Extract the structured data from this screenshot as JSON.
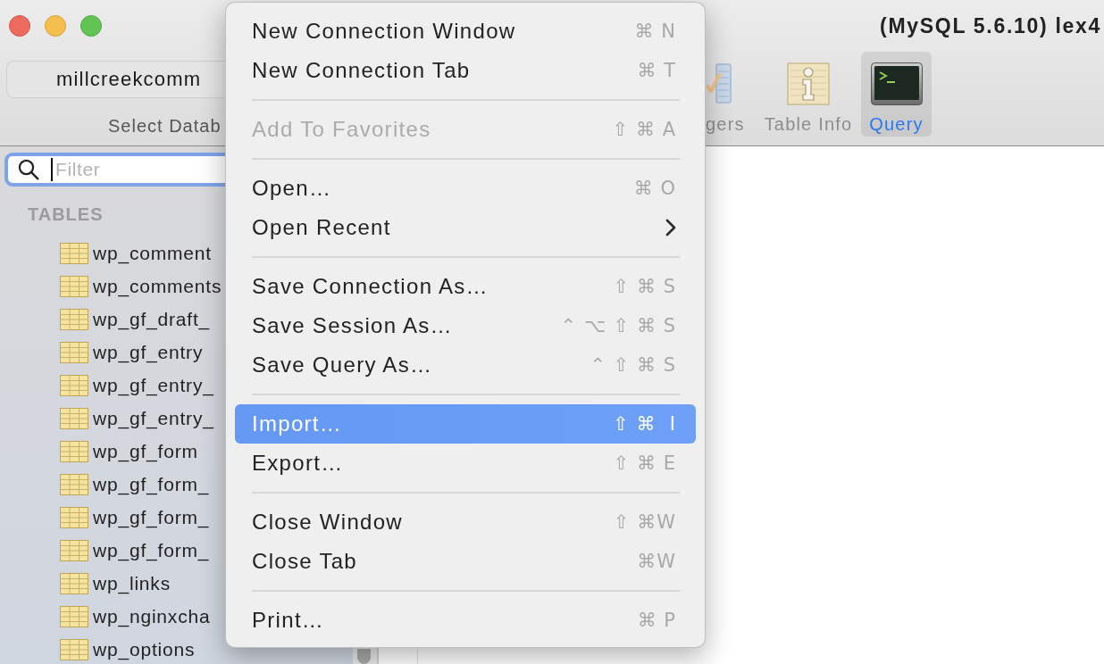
{
  "window": {
    "title": "(MySQL 5.6.10) lex4"
  },
  "toolbar": {
    "database": {
      "value": "millcreekcomm",
      "label": "Select Datab"
    },
    "items": [
      {
        "kind": "triggers",
        "label": "gers",
        "selected": false
      },
      {
        "kind": "info",
        "label": "Table Info",
        "selected": false
      },
      {
        "kind": "console",
        "label": "Query",
        "selected": true
      }
    ]
  },
  "sidebar": {
    "filter": {
      "placeholder": "Filter"
    },
    "heading": "TABLES",
    "tables": [
      {
        "name": "wp_comment",
        "selected": false
      },
      {
        "name": "wp_comments",
        "selected": false
      },
      {
        "name": "wp_gf_draft_",
        "selected": false
      },
      {
        "name": "wp_gf_entry",
        "selected": false
      },
      {
        "name": "wp_gf_entry_",
        "selected": false
      },
      {
        "name": "wp_gf_entry_",
        "selected": false
      },
      {
        "name": "wp_gf_form",
        "selected": false
      },
      {
        "name": "wp_gf_form_",
        "selected": false
      },
      {
        "name": "wp_gf_form_",
        "selected": false
      },
      {
        "name": "wp_gf_form_",
        "selected": false
      },
      {
        "name": "wp_links",
        "selected": false
      },
      {
        "name": "wp_nginxcha",
        "selected": false
      },
      {
        "name": "wp_options",
        "selected": false
      }
    ]
  },
  "file_menu": {
    "groups": [
      [
        {
          "label": "New Connection Window",
          "shortcut": "⌘ N",
          "disabled": false,
          "selected": false,
          "submenu": false
        },
        {
          "label": "New Connection Tab",
          "shortcut": "⌘ T",
          "disabled": false,
          "selected": false,
          "submenu": false
        }
      ],
      [
        {
          "label": "Add To Favorites",
          "shortcut": "⇧ ⌘ A",
          "disabled": true,
          "selected": false,
          "submenu": false
        }
      ],
      [
        {
          "label": "Open…",
          "shortcut": "⌘ O",
          "disabled": false,
          "selected": false,
          "submenu": false
        },
        {
          "label": "Open Recent",
          "disabled": false,
          "selected": false,
          "submenu": true
        }
      ],
      [
        {
          "label": "Save Connection As…",
          "shortcut": "⇧ ⌘ S",
          "disabled": false,
          "selected": false,
          "submenu": false
        },
        {
          "label": "Save Session As…",
          "shortcut": "⌃ ⌥ ⇧ ⌘ S",
          "disabled": false,
          "selected": false,
          "submenu": false
        },
        {
          "label": "Save Query As…",
          "shortcut": "⌃ ⇧ ⌘ S",
          "disabled": false,
          "selected": false,
          "submenu": false
        }
      ],
      [
        {
          "label": "Import…",
          "shortcut": "⇧ ⌘  I",
          "disabled": false,
          "selected": true,
          "submenu": false
        },
        {
          "label": "Export…",
          "shortcut": "⇧ ⌘ E",
          "disabled": false,
          "selected": false,
          "submenu": false
        }
      ],
      [
        {
          "label": "Close Window",
          "shortcut": "⇧ ⌘W",
          "disabled": false,
          "selected": false,
          "submenu": false
        },
        {
          "label": "Close Tab",
          "shortcut": "⌘W",
          "disabled": false,
          "selected": false,
          "submenu": false
        }
      ],
      [
        {
          "label": "Print…",
          "shortcut": "⌘ P",
          "disabled": false,
          "selected": false,
          "submenu": false
        }
      ]
    ]
  }
}
